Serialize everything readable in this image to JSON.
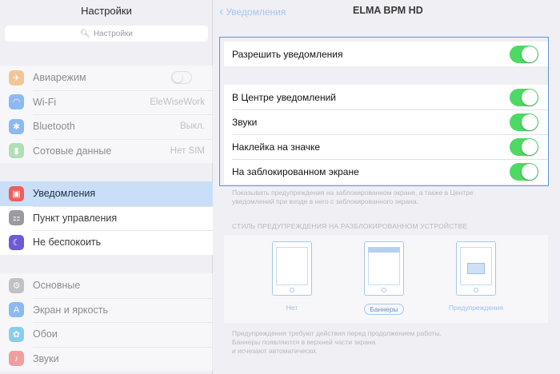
{
  "left": {
    "title": "Настройки",
    "search_placeholder": "Настройки",
    "group1": [
      {
        "icon": "airplane-icon",
        "color": "#f7a34b",
        "glyph": "✈",
        "label": "Авиарежим",
        "value": "",
        "toggle": true
      },
      {
        "icon": "wifi-icon",
        "color": "#3e8ef0",
        "glyph": "◠",
        "label": "Wi-Fi",
        "value": "EleWiseWork"
      },
      {
        "icon": "bluetooth-icon",
        "color": "#3e8ef0",
        "glyph": "✱",
        "label": "Bluetooth",
        "value": "Выкл."
      },
      {
        "icon": "cellular-icon",
        "color": "#7ed37f",
        "glyph": "▮",
        "label": "Сотовые данные",
        "value": "Нет SIM"
      }
    ],
    "group2": [
      {
        "icon": "notifications-icon",
        "color": "#f25d5a",
        "glyph": "▣",
        "label": "Уведомления",
        "selected": true
      },
      {
        "icon": "control-center-icon",
        "color": "#9a9aa0",
        "glyph": "⚏",
        "label": "Пункт управления"
      },
      {
        "icon": "do-not-disturb-icon",
        "color": "#6b5bd6",
        "glyph": "☾",
        "label": "Не беспокоить"
      }
    ],
    "group3": [
      {
        "icon": "gear-icon",
        "color": "#9a9aa0",
        "glyph": "⚙",
        "label": "Основные"
      },
      {
        "icon": "display-icon",
        "color": "#3e8ef0",
        "glyph": "A",
        "label": "Экран и яркость"
      },
      {
        "icon": "wallpaper-icon",
        "color": "#35b3e8",
        "glyph": "✿",
        "label": "Обои"
      },
      {
        "icon": "sounds-icon",
        "color": "#f25d5a",
        "glyph": "♪",
        "label": "Звуки"
      }
    ]
  },
  "right": {
    "back_label": "Уведомления",
    "title": "ELMA BPM HD",
    "allow_label": "Разрешить уведомления",
    "options": [
      {
        "label": "В Центре уведомлений",
        "on": true
      },
      {
        "label": "Звуки",
        "on": true
      },
      {
        "label": "Наклейка на значке",
        "on": true
      },
      {
        "label": "На заблокированном экране",
        "on": true
      }
    ],
    "lock_note_1": "Показывать предупреждения на заблокированном экране, а также в Центре",
    "lock_note_2": "уведомлений при входе в него с заблокированного экрана.",
    "style_header": "СТИЛЬ ПРЕДУПРЕЖДЕНИЯ НА РАЗБЛОКИРОВАННОМ УСТРОЙСТВЕ",
    "styles": [
      {
        "label": "Нет",
        "kind": "none"
      },
      {
        "label": "Баннеры",
        "kind": "banner",
        "selected": true
      },
      {
        "label": "Предупреждения",
        "kind": "alert"
      }
    ],
    "style_note_1": "Предупреждения требуют действия перед продолжением работы.",
    "style_note_2": "Баннеры появляются в верхней части экрана",
    "style_note_3": "и исчезают автоматически."
  }
}
